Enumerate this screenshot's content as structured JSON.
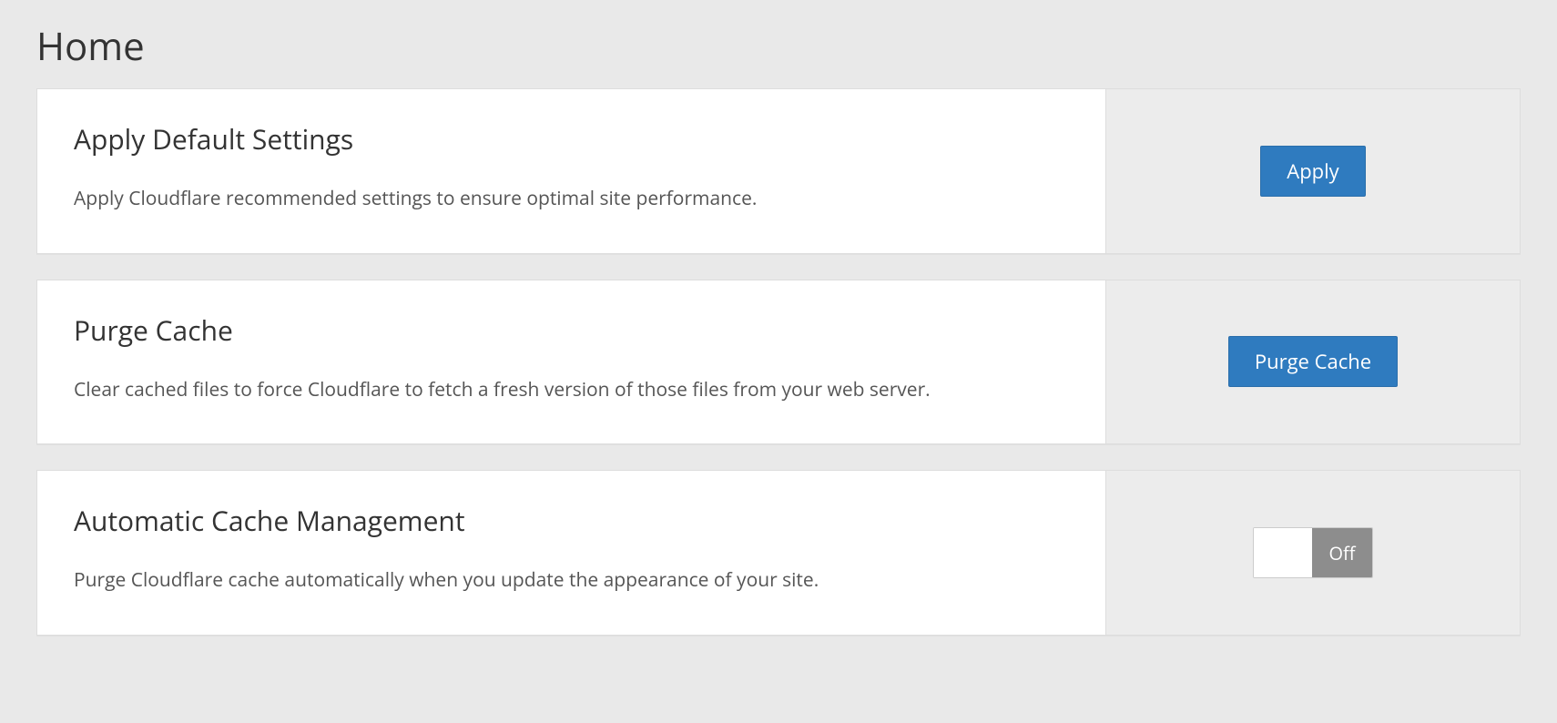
{
  "pageTitle": "Home",
  "cards": {
    "defaultSettings": {
      "heading": "Apply Default Settings",
      "description": "Apply Cloudflare recommended settings to ensure optimal site performance.",
      "buttonLabel": "Apply"
    },
    "purgeCache": {
      "heading": "Purge Cache",
      "description": "Clear cached files to force Cloudflare to fetch a fresh version of those files from your web server.",
      "buttonLabel": "Purge Cache"
    },
    "autoCache": {
      "heading": "Automatic Cache Management",
      "description": "Purge Cloudflare cache automatically when you update the appearance of your site.",
      "toggleLabel": "Off"
    }
  }
}
